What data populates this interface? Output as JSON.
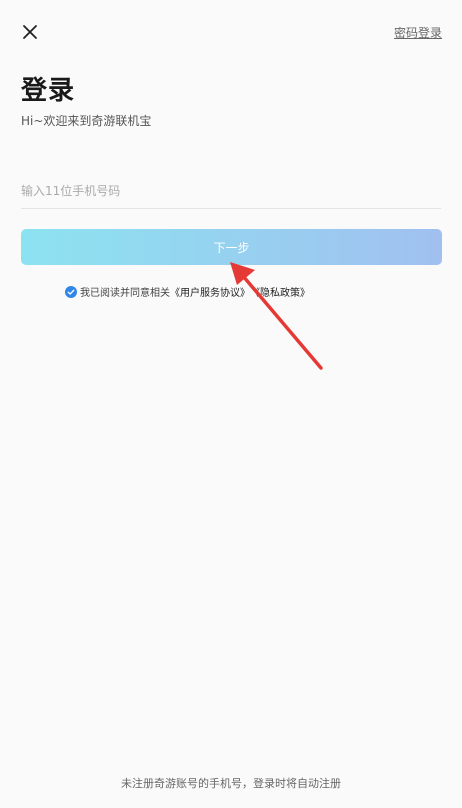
{
  "header": {
    "close_icon": "close-icon",
    "password_login_label": "密码登录"
  },
  "main": {
    "title": "登录",
    "subtitle": "Hi~欢迎来到奇游联机宝",
    "phone_input": {
      "value": "",
      "placeholder": "输入11位手机号码"
    },
    "next_button_label": "下一步",
    "agreement": {
      "checked": true,
      "prefix": "我已阅读并同意相关",
      "user_agreement": "《用户服务协议》",
      "privacy_policy": "《隐私政策》"
    }
  },
  "footer": {
    "note": "未注册奇游账号的手机号，登录时将自动注册"
  },
  "colors": {
    "button_gradient_start": "#8ce3f0",
    "button_gradient_end": "#a1c0f0",
    "check_blue": "#2f86e8",
    "annotation_arrow": "#e53935"
  }
}
